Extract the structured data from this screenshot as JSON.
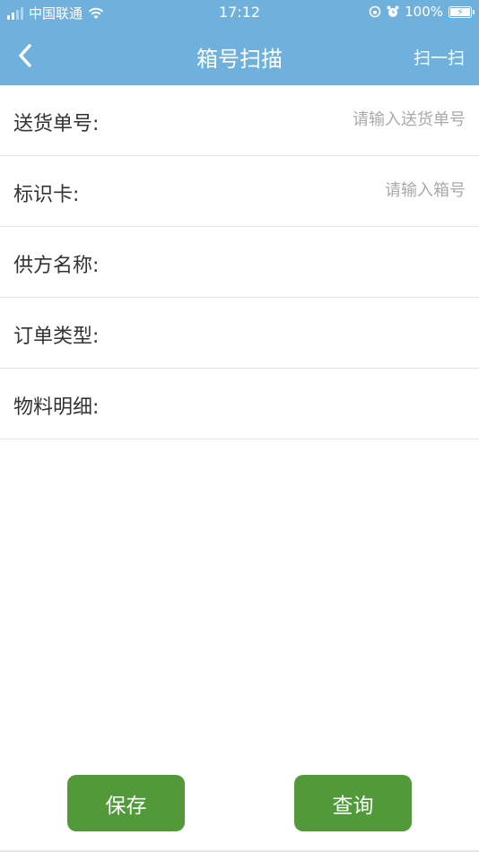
{
  "status_bar": {
    "carrier": "中国联通",
    "time": "17:12",
    "battery": "100%",
    "battery_level": 1.0
  },
  "nav": {
    "title": "箱号扫描",
    "scan_label": "扫一扫"
  },
  "form": {
    "fields": [
      {
        "label": "送货单号:",
        "placeholder": "请输入送货单号",
        "value": ""
      },
      {
        "label": "标识卡:",
        "placeholder": "请输入箱号",
        "value": ""
      },
      {
        "label": "供方名称:",
        "value": ""
      },
      {
        "label": "订单类型:",
        "value": ""
      },
      {
        "label": "物料明细:",
        "value": ""
      }
    ]
  },
  "actions": {
    "save_label": "保存",
    "query_label": "查询"
  },
  "colors": {
    "header": "#6fb1dc",
    "button": "#529a39"
  }
}
